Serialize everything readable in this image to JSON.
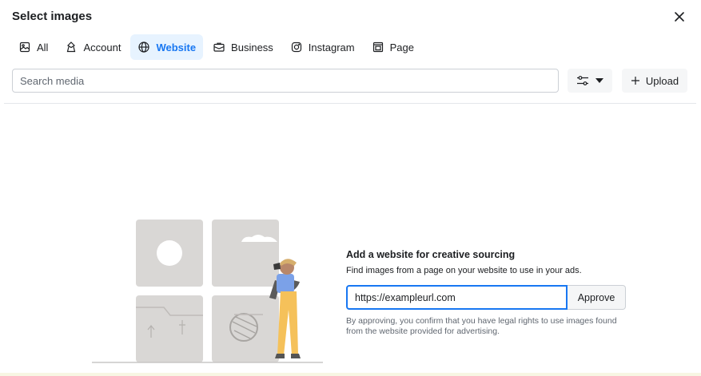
{
  "dialog": {
    "title": "Select images"
  },
  "tabs": [
    {
      "label": "All",
      "icon": "image-gallery-icon",
      "active": false
    },
    {
      "label": "Account",
      "icon": "account-badge-icon",
      "active": false
    },
    {
      "label": "Website",
      "icon": "globe-icon",
      "active": true
    },
    {
      "label": "Business",
      "icon": "briefcase-icon",
      "active": false
    },
    {
      "label": "Instagram",
      "icon": "instagram-icon",
      "active": false
    },
    {
      "label": "Page",
      "icon": "page-icon",
      "active": false
    }
  ],
  "search": {
    "placeholder": "Search media",
    "value": ""
  },
  "toolbar": {
    "filter_icon": "sliders-icon",
    "upload_label": "Upload"
  },
  "website_panel": {
    "title": "Add a website for creative sourcing",
    "subtitle": "Find images from a page on your website to use in your ads.",
    "url_value": "https://exampleurl.com",
    "approve_label": "Approve",
    "disclaimer": "By approving, you confirm that you have legal rights to use images found from the website provided for advertising."
  },
  "colors": {
    "accent": "#1877f2",
    "active_tab_bg": "#e7f3ff",
    "illustration_grey": "#d9d7d5",
    "figure_blue": "#7ba1e8",
    "figure_yellow": "#f5c15a"
  }
}
